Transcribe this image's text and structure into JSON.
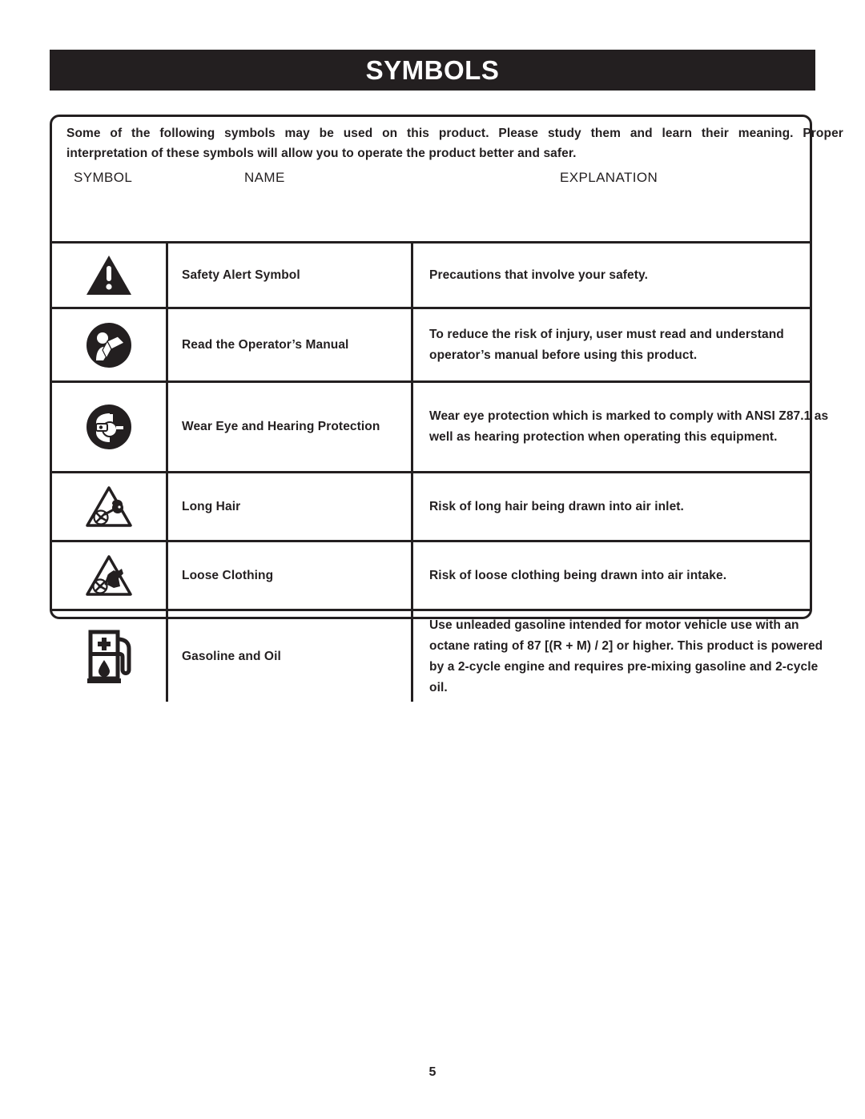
{
  "page": {
    "title": "SYMBOLS",
    "number": "5",
    "accent_color": "#231f20",
    "background_color": "#ffffff"
  },
  "intro": {
    "line1_words": [
      "Some",
      "of",
      "the",
      "following",
      "symbols",
      "may",
      "be",
      "used",
      "on",
      "this",
      "product.",
      "Please",
      "study",
      "them",
      "and",
      "learn",
      "their",
      "meaning.",
      "Proper"
    ],
    "line2": "interpretation of these symbols will allow you to operate the product better and safer."
  },
  "table": {
    "headers": {
      "symbol": "SYMBOL",
      "name": "NAME",
      "explanation": "EXPLANATION"
    },
    "rows": [
      {
        "icon": "safety-alert-triangle-icon",
        "name": "Safety Alert Symbol",
        "explanation": "Precautions that involve your safety."
      },
      {
        "icon": "read-operators-manual-icon",
        "name": "Read the Operator’s Manual",
        "explanation": "To reduce the risk of injury, user must read and understand operator’s manual before using this product."
      },
      {
        "icon": "eye-and-hearing-protection-icon",
        "name": "Wear Eye and Hearing Protection",
        "explanation": "Wear eye protection which is marked to comply with ANSI Z87.1 as well as hearing protection when operating this equipment."
      },
      {
        "icon": "long-hair-fan-warning-icon",
        "name": "Long Hair",
        "explanation": "Risk of long hair being drawn into air inlet."
      },
      {
        "icon": "loose-clothing-fan-warning-icon",
        "name": "Loose Clothing",
        "explanation": "Risk of loose clothing being drawn into air intake."
      },
      {
        "icon": "gasoline-and-oil-pump-icon",
        "name": "Gasoline and Oil",
        "explanation": "Use unleaded gasoline intended for motor vehicle use with an octane rating of 87 [(R + M) / 2] or higher. This product is powered by a 2-cycle engine and requires pre-mixing gasoline and 2-cycle oil."
      }
    ]
  }
}
